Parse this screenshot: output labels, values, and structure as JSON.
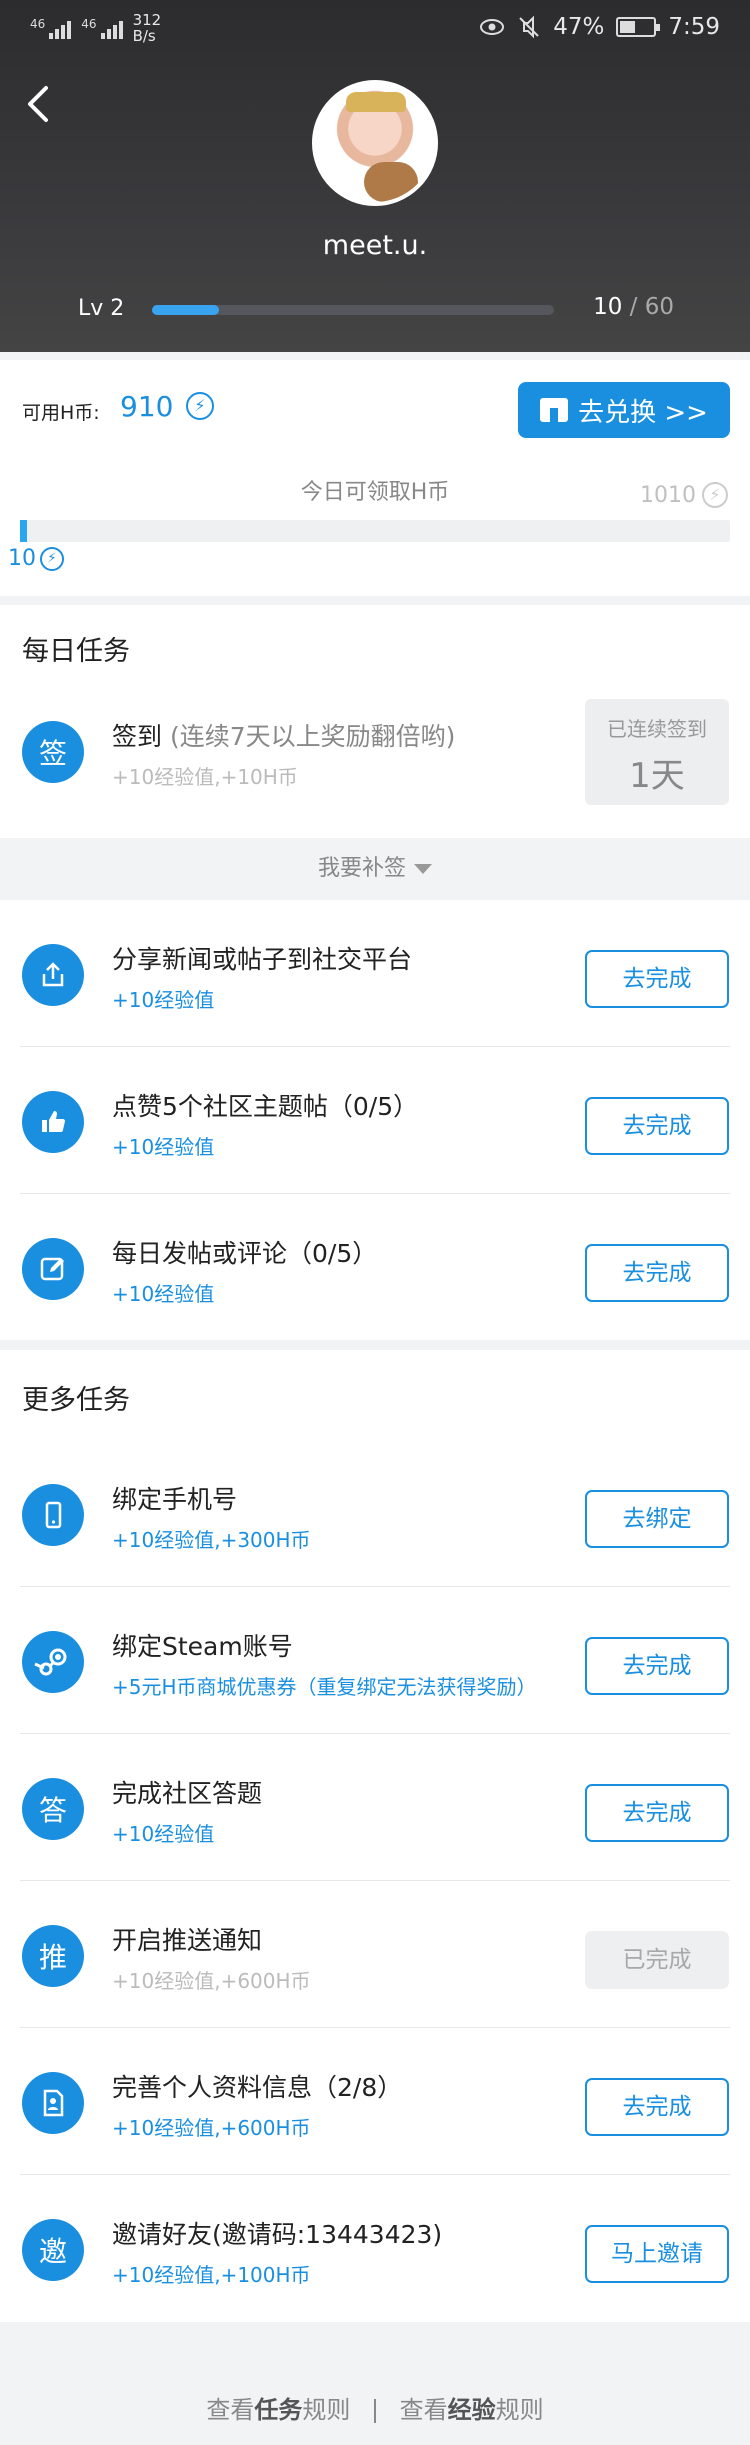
{
  "status_bar": {
    "signal1": "46",
    "signal2": "46",
    "speed_value": "312",
    "speed_unit": "B/s",
    "battery": "47%",
    "time": "7:59"
  },
  "profile": {
    "username": "meet.u.",
    "level_label": "Lv 2",
    "exp_current": "10",
    "exp_sep": " / ",
    "exp_total": "60",
    "exp_progress": 0.167
  },
  "coins": {
    "label": "可用H币:",
    "value": "910",
    "exchange_label": "去兑换 >>",
    "today_title": "今日可领取H币",
    "today_max": "1010",
    "today_current": "10",
    "coin_symbol": "⚡"
  },
  "daily": {
    "title": "每日任务",
    "signin": {
      "icon_text": "签",
      "name": "签到",
      "sub": "(连续7天以上奖励翻倍哟)",
      "reward": "+10经验值,+10H币",
      "streak_label": "已连续签到",
      "streak_value": "1天"
    },
    "makeup_label": "我要补签",
    "tasks": [
      {
        "name": "分享新闻或帖子到社交平台",
        "reward": "+10经验值",
        "button": "去完成"
      },
      {
        "name": "点赞5个社区主题帖（0/5）",
        "reward": "+10经验值",
        "button": "去完成"
      },
      {
        "name": "每日发帖或评论（0/5）",
        "reward": "+10经验值",
        "button": "去完成"
      }
    ]
  },
  "more": {
    "title": "更多任务",
    "tasks": [
      {
        "name": "绑定手机号",
        "reward": "+10经验值,+300H币",
        "button": "去绑定"
      },
      {
        "name": "绑定Steam账号",
        "reward": "+5元H币商城优惠券（重复绑定无法获得奖励）",
        "button": "去完成"
      },
      {
        "icon_text": "答",
        "name": "完成社区答题",
        "reward": "+10经验值",
        "button": "去完成"
      },
      {
        "icon_text": "推",
        "name": "开启推送通知",
        "reward": "+10经验值,+600H币",
        "button": "已完成"
      },
      {
        "name": "完善个人资料信息（2/8）",
        "reward": "+10经验值,+600H币",
        "button": "去完成"
      },
      {
        "icon_text": "邀",
        "name": "邀请好友(邀请码:13443423)",
        "reward": "+10经验值,+100H币",
        "button": "马上邀请"
      }
    ]
  },
  "footer": {
    "link1_pre": "查看",
    "link1_bold": "任务",
    "link1_post": "规则",
    "link2_pre": "查看",
    "link2_bold": "经验",
    "link2_post": "规则"
  },
  "colors": {
    "accent": "#1a8fe0",
    "header_bg": "#2c2c2e",
    "done_bg": "#eeeff1"
  }
}
